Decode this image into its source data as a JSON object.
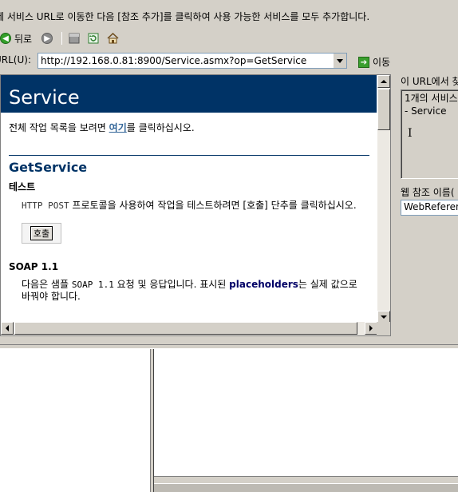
{
  "instruction": "에 서비스 URL로 이동한 다음 [참조 추가]를 클릭하여 사용 가능한 서비스를 모두 추가합니다.",
  "toolbar": {
    "back_label": "뒤로",
    "icons": [
      "back-icon",
      "forward-icon",
      "stop-icon",
      "refresh-icon",
      "home-icon"
    ]
  },
  "address": {
    "label": "URL(U):",
    "value": "http://192.168.0.81:8900/Service.asmx?op=GetService",
    "go_label": "이동"
  },
  "page": {
    "service_title": "Service",
    "intro_before": "전체 작업 목록을 보려면 ",
    "intro_link": "여기",
    "intro_after": "를 클릭하십시오.",
    "operation_title": "GetService",
    "test_heading": "테스트",
    "test_desc_code": "HTTP POST",
    "test_desc_text": " 프로토콜을 사용하여 작업을 테스트하려면 [호출] 단추를 클릭하십시오.",
    "invoke_button": "호출",
    "soap_heading": "SOAP 1.1",
    "soap_desc_before": "다음은 샘플 ",
    "soap_desc_code": "SOAP 1.1",
    "soap_desc_mid": " 요청 및 응답입니다. 표시된 ",
    "soap_desc_bold": "placeholders",
    "soap_desc_after": "는 실제 값으로 바꿔야 합니다."
  },
  "right_panel": {
    "label1": "이 URL에서 찾",
    "list_items": [
      "1개의 서비스",
      "- Service"
    ],
    "label2": "웹 참조 이름(",
    "ref_name": "WebReference"
  },
  "colors": {
    "header_bg": "#003366",
    "link": "#336699",
    "chrome": "#d4d0c8"
  }
}
